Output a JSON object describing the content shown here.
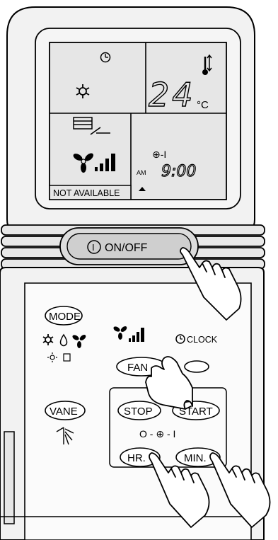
{
  "display": {
    "temperature": "24",
    "temp_unit": "°C",
    "timer_mode": "⊕-I",
    "am_pm": "AM",
    "time": "9:00",
    "not_available": "NOT AVAILABLE",
    "icons": [
      "clock-icon",
      "cool-mode-icon",
      "thermometer-icon",
      "vane-icon",
      "fan-speed-icon",
      "triangle-indicator-icon"
    ]
  },
  "buttons": {
    "onoff_symbol": "I",
    "onoff": "ON/OFF",
    "mode": "MODE",
    "fan": "FAN",
    "clock": "CLOCK",
    "vane": "VANE",
    "stop": "STOP",
    "start": "START",
    "timer_sequence": "O - ⊕ - I",
    "hr": "HR.",
    "min": "MIN."
  },
  "colors": {
    "body": "#f2f2f2",
    "display_panel": "#e6e6e6",
    "button_fill": "#d9d9d9",
    "outline": "#000000"
  }
}
